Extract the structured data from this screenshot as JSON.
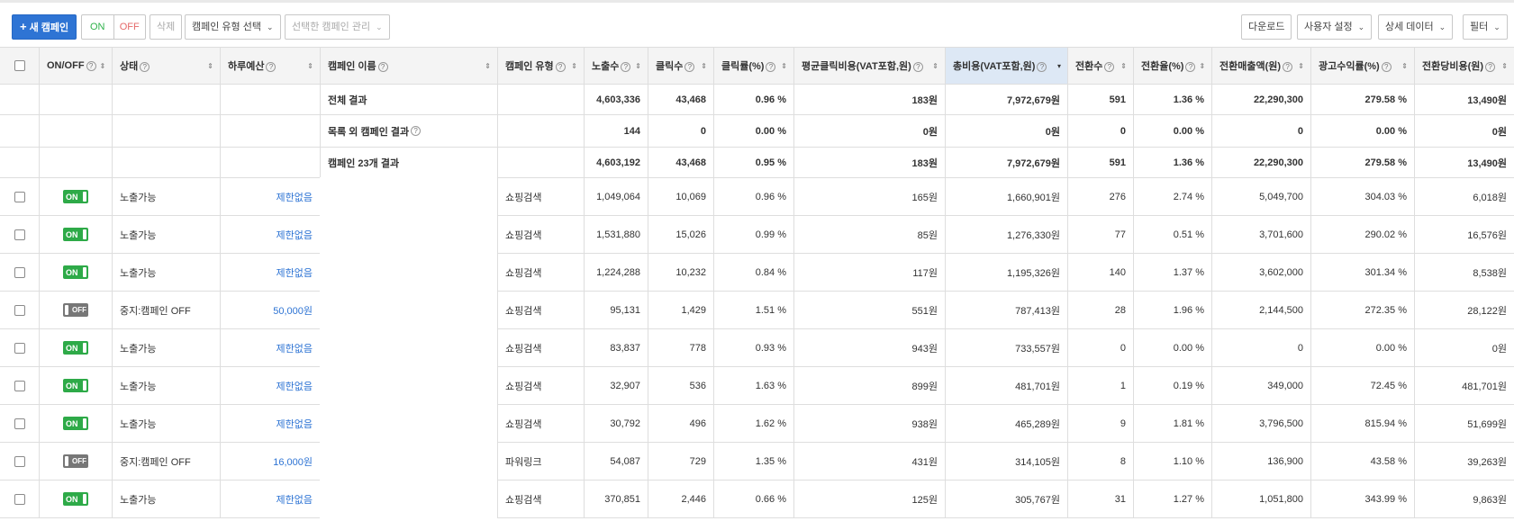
{
  "toolbar": {
    "new_campaign": "새 캠페인",
    "on": "ON",
    "off": "OFF",
    "delete": "삭제",
    "type_select": "캠페인 유형 선택",
    "manage_selected": "선택한 캠페인 관리",
    "download": "다운로드",
    "user_settings": "사용자 설정",
    "detail_data": "상세 데이터",
    "filter": "필터"
  },
  "columns": [
    {
      "label": "ON/OFF",
      "help": true
    },
    {
      "label": "상태",
      "help": true
    },
    {
      "label": "하루예산",
      "help": true
    },
    {
      "label": "캠페인 이름",
      "help": true
    },
    {
      "label": "캠페인 유형",
      "help": true
    },
    {
      "label": "노출수",
      "help": true
    },
    {
      "label": "클릭수",
      "help": true
    },
    {
      "label": "클릭률(%)",
      "help": true
    },
    {
      "label": "평균클릭비용(VAT포함,원)",
      "help": true
    },
    {
      "label": "총비용(VAT포함,원)",
      "help": true
    },
    {
      "label": "전환수",
      "help": true
    },
    {
      "label": "전환율(%)",
      "help": true
    },
    {
      "label": "전환매출액(원)",
      "help": true
    },
    {
      "label": "광고수익률(%)",
      "help": true
    },
    {
      "label": "전환당비용(원)",
      "help": true
    }
  ],
  "summary": [
    {
      "name": "전체 결과",
      "help": false,
      "values": [
        "4,603,336",
        "43,468",
        "0.96 %",
        "183원",
        "7,972,679원",
        "591",
        "1.36 %",
        "22,290,300",
        "279.58 %",
        "13,490원"
      ]
    },
    {
      "name": "목록 외 캠페인 결과",
      "help": true,
      "values": [
        "144",
        "0",
        "0.00 %",
        "0원",
        "0원",
        "0",
        "0.00 %",
        "0",
        "0.00 %",
        "0원"
      ]
    },
    {
      "name": "캠페인 23개 결과",
      "help": false,
      "values": [
        "4,603,192",
        "43,468",
        "0.95 %",
        "183원",
        "7,972,679원",
        "591",
        "1.36 %",
        "22,290,300",
        "279.58 %",
        "13,490원"
      ]
    }
  ],
  "rows": [
    {
      "toggle": "ON",
      "status": "노출가능",
      "budget": "제한없음",
      "type": "쇼핑검색",
      "values": [
        "1,049,064",
        "10,069",
        "0.96 %",
        "165원",
        "1,660,901원",
        "276",
        "2.74 %",
        "5,049,700",
        "304.03 %",
        "6,018원"
      ]
    },
    {
      "toggle": "ON",
      "status": "노출가능",
      "budget": "제한없음",
      "type": "쇼핑검색",
      "values": [
        "1,531,880",
        "15,026",
        "0.99 %",
        "85원",
        "1,276,330원",
        "77",
        "0.51 %",
        "3,701,600",
        "290.02 %",
        "16,576원"
      ]
    },
    {
      "toggle": "ON",
      "status": "노출가능",
      "budget": "제한없음",
      "type": "쇼핑검색",
      "values": [
        "1,224,288",
        "10,232",
        "0.84 %",
        "117원",
        "1,195,326원",
        "140",
        "1.37 %",
        "3,602,000",
        "301.34 %",
        "8,538원"
      ]
    },
    {
      "toggle": "OFF",
      "status": "중지:캠페인 OFF",
      "budget": "50,000원",
      "type": "쇼핑검색",
      "values": [
        "95,131",
        "1,429",
        "1.51 %",
        "551원",
        "787,413원",
        "28",
        "1.96 %",
        "2,144,500",
        "272.35 %",
        "28,122원"
      ]
    },
    {
      "toggle": "ON",
      "status": "노출가능",
      "budget": "제한없음",
      "type": "쇼핑검색",
      "values": [
        "83,837",
        "778",
        "0.93 %",
        "943원",
        "733,557원",
        "0",
        "0.00 %",
        "0",
        "0.00 %",
        "0원"
      ]
    },
    {
      "toggle": "ON",
      "status": "노출가능",
      "budget": "제한없음",
      "type": "쇼핑검색",
      "values": [
        "32,907",
        "536",
        "1.63 %",
        "899원",
        "481,701원",
        "1",
        "0.19 %",
        "349,000",
        "72.45 %",
        "481,701원"
      ]
    },
    {
      "toggle": "ON",
      "status": "노출가능",
      "budget": "제한없음",
      "type": "쇼핑검색",
      "values": [
        "30,792",
        "496",
        "1.62 %",
        "938원",
        "465,289원",
        "9",
        "1.81 %",
        "3,796,500",
        "815.94 %",
        "51,699원"
      ]
    },
    {
      "toggle": "OFF",
      "status": "중지:캠페인 OFF",
      "budget": "16,000원",
      "type": "파워링크",
      "values": [
        "54,087",
        "729",
        "1.35 %",
        "431원",
        "314,105원",
        "8",
        "1.10 %",
        "136,900",
        "43.58 %",
        "39,263원"
      ]
    },
    {
      "toggle": "ON",
      "status": "노출가능",
      "budget": "제한없음",
      "type": "쇼핑검색",
      "values": [
        "370,851",
        "2,446",
        "0.66 %",
        "125원",
        "305,767원",
        "31",
        "1.27 %",
        "1,051,800",
        "343.99 %",
        "9,863원"
      ]
    }
  ]
}
